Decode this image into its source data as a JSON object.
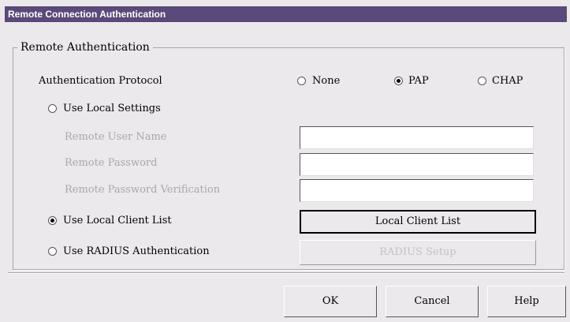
{
  "window": {
    "title": "Remote Connection Authentication"
  },
  "group": {
    "title": "Remote Authentication"
  },
  "protocol": {
    "label": "Authentication Protocol",
    "options": [
      {
        "label": "None",
        "selected": false
      },
      {
        "label": "PAP",
        "selected": true
      },
      {
        "label": "CHAP",
        "selected": false
      }
    ]
  },
  "modes": {
    "local_settings": {
      "label": "Use Local Settings",
      "selected": false
    },
    "local_client_list": {
      "label": "Use Local Client List",
      "selected": true
    },
    "radius": {
      "label": "Use RADIUS Authentication",
      "selected": false
    }
  },
  "fields": {
    "user_name": {
      "label": "Remote User Name",
      "value": ""
    },
    "password": {
      "label": "Remote Password",
      "value": ""
    },
    "password_verification": {
      "label": "Remote Password Verification",
      "value": ""
    }
  },
  "buttons": {
    "local_client_list": "Local Client List",
    "radius_setup": "RADIUS Setup",
    "ok": "OK",
    "cancel": "Cancel",
    "help": "Help"
  }
}
